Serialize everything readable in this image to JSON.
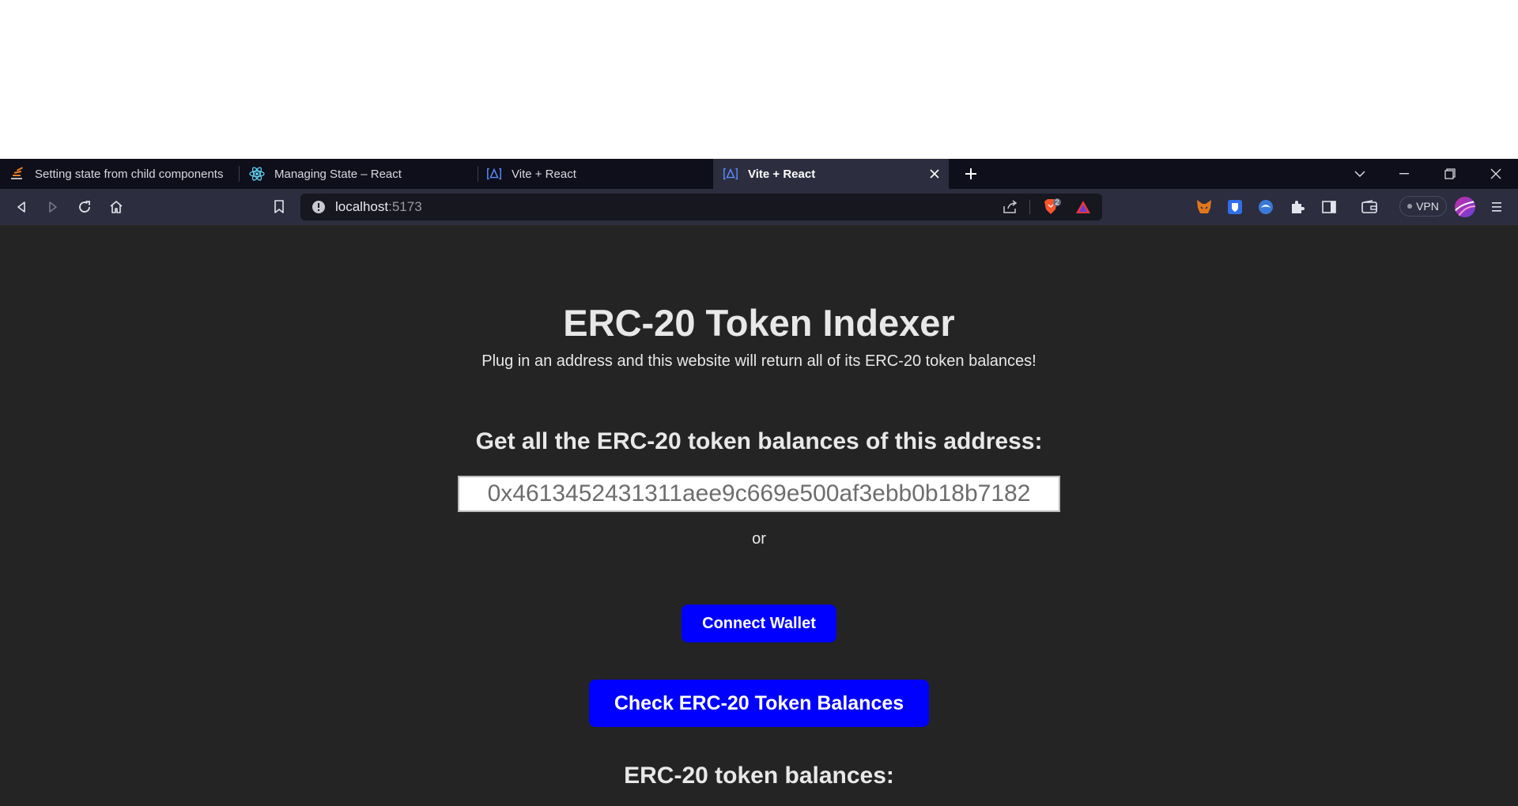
{
  "browser": {
    "tabs": [
      {
        "title": "Setting state from child components",
        "icon": "stackoverflow-icon",
        "active": false
      },
      {
        "title": "Managing State – React",
        "icon": "react-icon",
        "active": false
      },
      {
        "title": "Vite + React",
        "icon": "vite-icon",
        "active": false
      },
      {
        "title": "Vite + React",
        "icon": "vite-icon",
        "active": true
      }
    ],
    "url": {
      "host": "localhost",
      "port": ":5173"
    },
    "brave_badge": "2",
    "vpn_label": "VPN"
  },
  "page": {
    "title": "ERC-20 Token Indexer",
    "subtitle": "Plug in an address and this website will return all of its ERC-20 token balances!",
    "section_heading": "Get all the ERC-20 token balances of this address:",
    "address_value": "0x4613452431311aee9c669e500af3ebb0b18b7182",
    "or_text": "or",
    "connect_wallet_label": "Connect Wallet",
    "check_balances_label": "Check ERC-20 Token Balances",
    "results_heading": "ERC-20 token balances:"
  },
  "colors": {
    "page_background": "#242424",
    "button_blue": "#0000ff",
    "tab_strip": "#0e0f1a",
    "toolbar": "#2c2d3e"
  }
}
